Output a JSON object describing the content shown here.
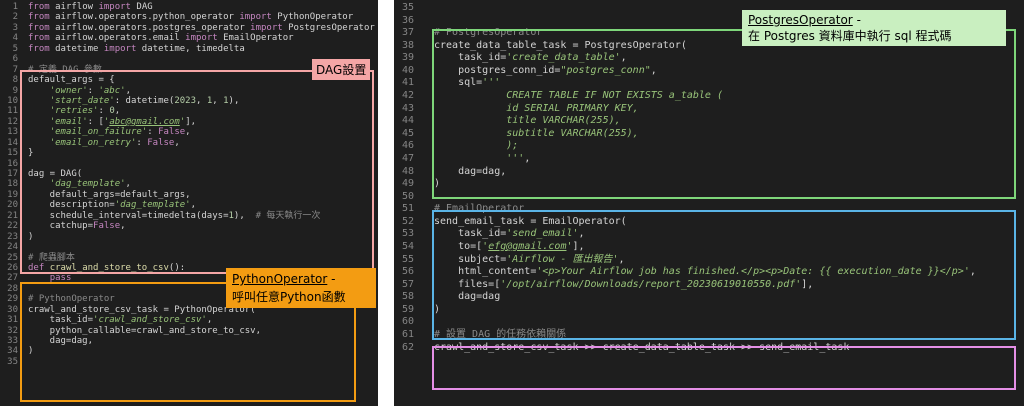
{
  "left_panel": {
    "lines": [
      {
        "n": "1",
        "html": "<span class='kw'>from</span> airflow <span class='kw'>import</span> DAG"
      },
      {
        "n": "2",
        "html": "<span class='kw'>from</span> airflow.operators.python_operator <span class='kw'>import</span> PythonOperator"
      },
      {
        "n": "3",
        "html": "<span class='kw'>from</span> airflow.operators.postgres_operator <span class='kw'>import</span> PostgresOperator"
      },
      {
        "n": "4",
        "html": "<span class='kw'>from</span> airflow.operators.email <span class='kw'>import</span> EmailOperator"
      },
      {
        "n": "5",
        "html": "<span class='kw'>from</span> datetime <span class='kw'>import</span> datetime, timedelta"
      },
      {
        "n": "6",
        "html": ""
      },
      {
        "n": "7",
        "html": "<span class='com'># 定義 DAG 參數</span>"
      },
      {
        "n": "8",
        "html": "default_args = {"
      },
      {
        "n": "9",
        "html": "    <span class='str'>'owner'</span>: <span class='str'>'abc'</span>,"
      },
      {
        "n": "10",
        "html": "    <span class='str'>'start_date'</span>: datetime(<span class='num'>2023</span>, <span class='num'>1</span>, <span class='num'>1</span>),"
      },
      {
        "n": "11",
        "html": "    <span class='str'>'retries'</span>: <span class='num'>0</span>,"
      },
      {
        "n": "12",
        "html": "    <span class='str'>'email'</span>: [<span class='str'>'<span class=\"u\">abc@gmail.com</span>'</span>],"
      },
      {
        "n": "13",
        "html": "    <span class='str'>'email_on_failure'</span>: <span class='kw'>False</span>,"
      },
      {
        "n": "14",
        "html": "    <span class='str'>'email_on_retry'</span>: <span class='kw'>False</span>,"
      },
      {
        "n": "15",
        "html": "}"
      },
      {
        "n": "16",
        "html": ""
      },
      {
        "n": "17",
        "html": "dag = DAG("
      },
      {
        "n": "18",
        "html": "    <span class='str'>'dag_template'</span>,"
      },
      {
        "n": "19",
        "html": "    default_args=default_args,"
      },
      {
        "n": "20",
        "html": "    description=<span class='str'>'dag_template'</span>,"
      },
      {
        "n": "21",
        "html": "    schedule_interval=timedelta(days=<span class='num'>1</span>),  <span class='com'># 每天執行一次</span>"
      },
      {
        "n": "22",
        "html": "    catchup=<span class='kw'>False</span>,"
      },
      {
        "n": "23",
        "html": ")"
      },
      {
        "n": "24",
        "html": ""
      },
      {
        "n": "25",
        "html": "<span class='com'># 爬蟲腳本</span>"
      },
      {
        "n": "26",
        "html": "<span class='kw'>def</span> <span class='fn'>crawl_and_store_to_csv</span>():"
      },
      {
        "n": "27",
        "html": "    <span class='kw'>pass</span>"
      },
      {
        "n": "28",
        "html": ""
      },
      {
        "n": "29",
        "html": "<span class='com'># PythonOperator</span>"
      },
      {
        "n": "30",
        "html": "crawl_and_store_csv_task = PythonOperator("
      },
      {
        "n": "31",
        "html": "    task_id=<span class='str'>'crawl_and_store_csv'</span>,"
      },
      {
        "n": "32",
        "html": "    python_callable=crawl_and_store_to_csv,"
      },
      {
        "n": "33",
        "html": "    dag=dag,"
      },
      {
        "n": "34",
        "html": ")"
      },
      {
        "n": "35",
        "html": ""
      }
    ]
  },
  "right_panel": {
    "lines": [
      {
        "n": "35",
        "html": ""
      },
      {
        "n": "36",
        "html": ""
      },
      {
        "n": "37",
        "html": "<span class='com'># PostgresOperator</span>"
      },
      {
        "n": "38",
        "html": "create_data_table_task = PostgresOperator("
      },
      {
        "n": "39",
        "html": "    task_id=<span class='str'>'create_data_table'</span>,"
      },
      {
        "n": "40",
        "html": "    postgres_conn_id=<span class='str'>\"postgres_conn\"</span>,"
      },
      {
        "n": "41",
        "html": "    sql=<span class='str'>'''</span>"
      },
      {
        "n": "42",
        "html": "<span class='str'>            CREATE TABLE IF NOT EXISTS a_table (</span>"
      },
      {
        "n": "43",
        "html": "<span class='str'>            id SERIAL PRIMARY KEY,</span>"
      },
      {
        "n": "44",
        "html": "<span class='str'>            title VARCHAR(255),</span>"
      },
      {
        "n": "45",
        "html": "<span class='str'>            subtitle VARCHAR(255),</span>"
      },
      {
        "n": "46",
        "html": "<span class='str'>            );</span>"
      },
      {
        "n": "47",
        "html": "<span class='str'>            '''</span>,"
      },
      {
        "n": "48",
        "html": "    dag=dag,"
      },
      {
        "n": "49",
        "html": ")"
      },
      {
        "n": "50",
        "html": ""
      },
      {
        "n": "51",
        "html": "<span class='com'># EmailOperator</span>"
      },
      {
        "n": "52",
        "html": "send_email_task = EmailOperator("
      },
      {
        "n": "53",
        "html": "    task_id=<span class='str'>'send_email'</span>,"
      },
      {
        "n": "54",
        "html": "    to=[<span class='str'>'<span class=\"u\">efg@gmail.com</span>'</span>],"
      },
      {
        "n": "55",
        "html": "    subject=<span class='str'>'Airflow - 匯出報告'</span>,"
      },
      {
        "n": "56",
        "html": "    html_content=<span class='str'>'&lt;p&gt;Your Airflow job has finished.&lt;/p&gt;&lt;p&gt;Date: {{ execution_date }}&lt;/p&gt;'</span>,"
      },
      {
        "n": "57",
        "html": "    files=[<span class='str'>'/opt/airflow/Downloads/report_20230619010550.pdf'</span>],"
      },
      {
        "n": "58",
        "html": "    dag=dag"
      },
      {
        "n": "59",
        "html": ")"
      },
      {
        "n": "60",
        "html": ""
      },
      {
        "n": "61",
        "html": "<span class='com'># 設置 DAG 的任務依賴關係</span>"
      },
      {
        "n": "62",
        "html": "crawl_and_store_csv_task &gt;&gt; create_data_table_task &gt;&gt; send_email_task"
      }
    ]
  },
  "annotations": {
    "dag": {
      "label": "DAG設置",
      "color": "#f4a6a6"
    },
    "python": {
      "title": "PythonOperator",
      "suffix": " -",
      "desc": "呼叫任意Python函數",
      "color": "#f39c12"
    },
    "postgres": {
      "title": "PostgresOperator",
      "suffix": " -",
      "desc": "在 Postgres 資料庫中執行 sql 程式碼",
      "color": "#c9efc0",
      "border": "#7ed67a"
    },
    "email": {
      "border": "#5ab4e6"
    },
    "deps": {
      "border": "#e48fe6"
    }
  }
}
